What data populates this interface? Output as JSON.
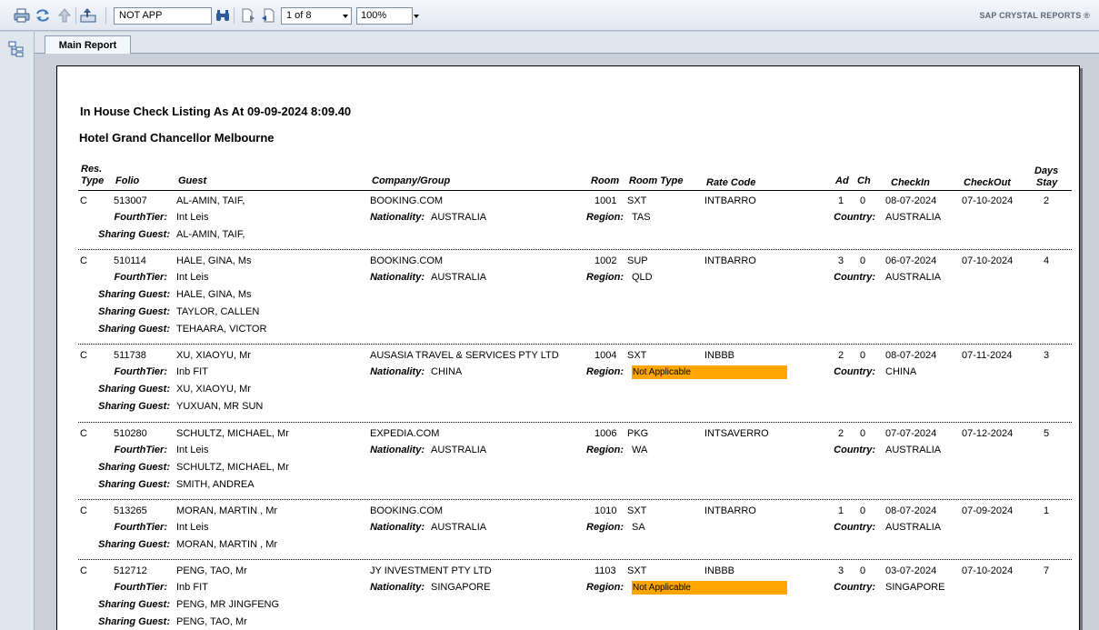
{
  "toolbar": {
    "search_value": "NOT APP",
    "page_value": "1 of 8",
    "zoom_value": "100%",
    "brand": "SAP CRYSTAL REPORTS ®"
  },
  "tabs": [
    {
      "label": "Main Report"
    }
  ],
  "report": {
    "title": "In House Check Listing As At  09-09-2024    8:09.40",
    "hotel": "Hotel Grand Chancellor Melbourne",
    "headers": {
      "res_type_1": "Res.",
      "res_type_2": "Type",
      "folio": "Folio",
      "guest": "Guest",
      "company": "Company/Group",
      "room": "Room",
      "room_type": "Room Type",
      "rate_code": "Rate Code",
      "ad": "Ad",
      "ch": "Ch",
      "checkin": "CheckIn",
      "checkout": "CheckOut",
      "days_1": "Days",
      "days_2": "Stay"
    },
    "labels": {
      "fourth_tier": "FourthTier:",
      "sharing_guest": "Sharing Guest:",
      "nationality": "Nationality:",
      "region": "Region:",
      "country": "Country:"
    },
    "records": [
      {
        "type": "C",
        "folio": "513007",
        "guest": "AL-AMIN, TAIF,",
        "fourth_tier": "Int Leis",
        "sharing": [
          "AL-AMIN, TAIF,"
        ],
        "company": "BOOKING.COM",
        "nationality": "AUSTRALIA",
        "room": "1001",
        "room_type": "SXT",
        "region": "TAS",
        "region_highlight": false,
        "rate_code": "INTBARRO",
        "ad": "1",
        "ch": "0",
        "checkin": "08-07-2024",
        "checkout": "07-10-2024",
        "country": "AUSTRALIA",
        "days": "2"
      },
      {
        "type": "C",
        "folio": "510114",
        "guest": "HALE, GINA, Ms",
        "fourth_tier": "Int Leis",
        "sharing": [
          "HALE, GINA, Ms",
          "TAYLOR, CALLEN",
          "TEHAARA, VICTOR"
        ],
        "company": "BOOKING.COM",
        "nationality": "AUSTRALIA",
        "room": "1002",
        "room_type": "SUP",
        "region": "QLD",
        "region_highlight": false,
        "rate_code": "INTBARRO",
        "ad": "3",
        "ch": "0",
        "checkin": "06-07-2024",
        "checkout": "07-10-2024",
        "country": "AUSTRALIA",
        "days": "4"
      },
      {
        "type": "C",
        "folio": "511738",
        "guest": "XU, XIAOYU, Mr",
        "fourth_tier": "Inb FIT",
        "sharing": [
          "XU, XIAOYU, Mr",
          "YUXUAN, MR SUN"
        ],
        "company": "AUSASIA TRAVEL & SERVICES PTY LTD",
        "nationality": "CHINA",
        "room": "1004",
        "room_type": "SXT",
        "region": "Not Applicable",
        "region_highlight": true,
        "rate_code": "INBBB",
        "ad": "2",
        "ch": "0",
        "checkin": "08-07-2024",
        "checkout": "07-11-2024",
        "country": "CHINA",
        "days": "3"
      },
      {
        "type": "C",
        "folio": "510280",
        "guest": "SCHULTZ, MICHAEL, Mr",
        "fourth_tier": "Int Leis",
        "sharing": [
          "SCHULTZ, MICHAEL, Mr",
          "SMITH, ANDREA"
        ],
        "company": "EXPEDIA.COM",
        "nationality": "AUSTRALIA",
        "room": "1006",
        "room_type": "PKG",
        "region": "WA",
        "region_highlight": false,
        "rate_code": "INTSAVERRO",
        "ad": "2",
        "ch": "0",
        "checkin": "07-07-2024",
        "checkout": "07-12-2024",
        "country": "AUSTRALIA",
        "days": "5"
      },
      {
        "type": "C",
        "folio": "513265",
        "guest": "MORAN, MARTIN , Mr",
        "fourth_tier": "Int Leis",
        "sharing": [
          "MORAN, MARTIN , Mr"
        ],
        "company": "BOOKING.COM",
        "nationality": "AUSTRALIA",
        "room": "1010",
        "room_type": "SXT",
        "region": "SA",
        "region_highlight": false,
        "rate_code": "INTBARRO",
        "ad": "1",
        "ch": "0",
        "checkin": "08-07-2024",
        "checkout": "07-09-2024",
        "country": "AUSTRALIA",
        "days": "1"
      },
      {
        "type": "C",
        "folio": "512712",
        "guest": "PENG, TAO, Mr",
        "fourth_tier": "Inb FIT",
        "sharing": [
          "PENG, MR JINGFENG",
          "PENG, TAO, Mr"
        ],
        "company": "JY INVESTMENT PTY LTD",
        "nationality": "SINGAPORE",
        "room": "1103",
        "room_type": "SXT",
        "region": "Not Applicable",
        "region_highlight": true,
        "rate_code": "INBBB",
        "ad": "3",
        "ch": "0",
        "checkin": "03-07-2024",
        "checkout": "07-10-2024",
        "country": "SINGAPORE",
        "days": "7"
      }
    ],
    "highlight_color": "#ffa500"
  }
}
